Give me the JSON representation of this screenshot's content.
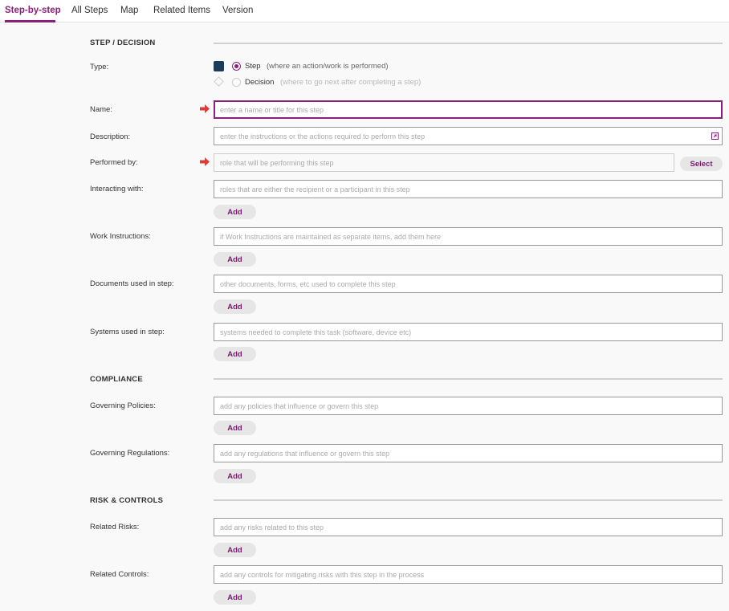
{
  "tabs": [
    {
      "label": "Step-by-step"
    },
    {
      "label": "All Steps"
    },
    {
      "label": "Map"
    },
    {
      "label": "Related Items"
    },
    {
      "label": "Version"
    }
  ],
  "accent_color": "#8b1f7c",
  "sections": {
    "step_decision": "STEP / DECISION",
    "compliance": "COMPLIANCE",
    "risk_controls": "RISK & CONTROLS"
  },
  "type": {
    "label": "Type:",
    "options": [
      {
        "label": "Step",
        "hint": "(where an action/work is performed)",
        "selected": true,
        "icon": "square-icon"
      },
      {
        "label": "Decision",
        "hint": "(where to go next after completing a step)",
        "selected": false,
        "icon": "diamond-icon"
      }
    ]
  },
  "fields": {
    "name": {
      "label": "Name:",
      "placeholder": "enter a name or title for this step",
      "value": ""
    },
    "description": {
      "label": "Description:",
      "placeholder": "enter the instructions or the actions required to perform this step",
      "value": ""
    },
    "performed_by": {
      "label": "Performed by:",
      "placeholder": "role that will be performing this step",
      "value": ""
    },
    "interacting_with": {
      "label": "Interacting with:",
      "placeholder": "roles that are either the recipient or a participant in this step",
      "value": ""
    },
    "work_instructions": {
      "label": "Work Instructions:",
      "placeholder": "if Work Instructions are maintained as separate items, add them here",
      "value": ""
    },
    "documents": {
      "label": "Documents used in step:",
      "placeholder": "other documents, forms, etc used to complete this step",
      "value": ""
    },
    "systems": {
      "label": "Systems used in step:",
      "placeholder": "systems needed to complete this task (software, device etc)",
      "value": ""
    },
    "governing_policies": {
      "label": "Governing Policies:",
      "placeholder": "add any policies that influence or govern this step",
      "value": ""
    },
    "governing_regulations": {
      "label": "Governing Regulations:",
      "placeholder": "add any regulations that influence or govern this step",
      "value": ""
    },
    "related_risks": {
      "label": "Related Risks:",
      "placeholder": "add any risks related to this step",
      "value": ""
    },
    "related_controls": {
      "label": "Related Controls:",
      "placeholder": "add any controls for mitigating risks with this step in the process",
      "value": ""
    }
  },
  "buttons": {
    "add": "Add",
    "select": "Select"
  },
  "icons": {
    "required": "arrow-right-icon",
    "expand": "expand-icon"
  }
}
